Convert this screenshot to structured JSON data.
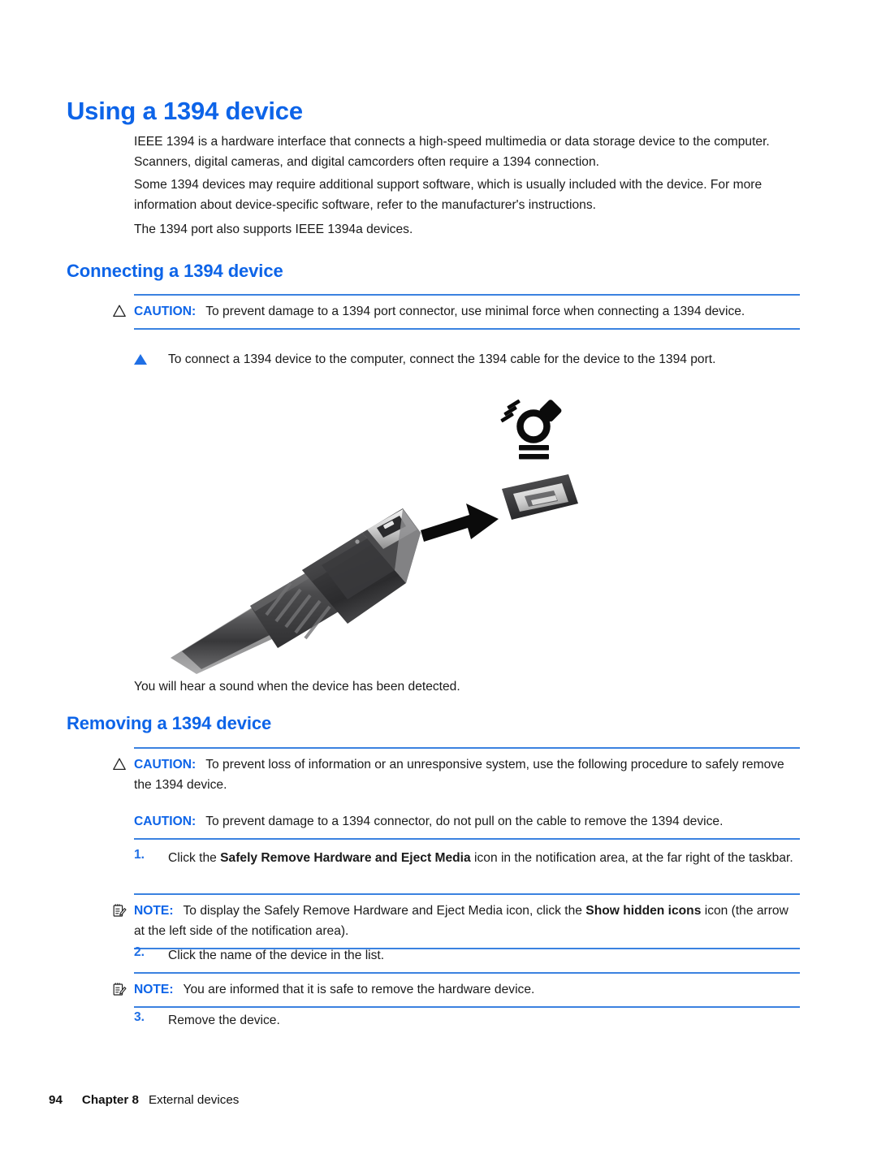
{
  "document": {
    "title": "Using a 1394 device",
    "intro_paragraphs": [
      "IEEE 1394 is a hardware interface that connects a high-speed multimedia or data storage device to the computer. Scanners, digital cameras, and digital camcorders often require a 1394 connection.",
      "Some 1394 devices may require additional support software, which is usually included with the device. For more information about device-specific software, refer to the manufacturer's instructions.",
      "The 1394 port also supports IEEE 1394a devices."
    ]
  },
  "connecting": {
    "heading": "Connecting a 1394 device",
    "caution_label": "CAUTION:",
    "caution_text": "To prevent damage to a 1394 port connector, use minimal force when connecting a 1394 device.",
    "bullet_text": "To connect a 1394 device to the computer, connect the 1394 cable for the device to the 1394 port.",
    "after_figure_text": "You will hear a sound when the device has been detected."
  },
  "figure": {
    "alt": "1394 cable connector being inserted into a 1394 port on the computer",
    "port_symbol_name": "firewire-1394-symbol",
    "arrow_name": "insertion-arrow"
  },
  "removing": {
    "heading": "Removing a 1394 device",
    "caution1_label": "CAUTION:",
    "caution1_text": "To prevent loss of information or an unresponsive system, use the following procedure to safely remove the 1394 device.",
    "caution2_label": "CAUTION:",
    "caution2_text": "To prevent damage to a 1394 connector, do not pull on the cable to remove the 1394 device.",
    "steps": [
      {
        "number": "1.",
        "text_before": "Click the ",
        "text_bold": "Safely Remove Hardware and Eject Media",
        "text_after": " icon in the notification area, at the far right of the taskbar."
      },
      {
        "number": "2.",
        "text_before": "Click the name of the device in the list.",
        "text_bold": "",
        "text_after": ""
      },
      {
        "number": "3.",
        "text_before": "Remove the device.",
        "text_bold": "",
        "text_after": ""
      }
    ],
    "note1_label": "NOTE:",
    "note1_before": "To display the Safely Remove Hardware and Eject Media icon, click the ",
    "note1_bold": "Show hidden icons",
    "note1_after": " icon (the arrow at the left side of the notification area).",
    "note2_label": "NOTE:",
    "note2_text": "You are informed that it is safe to remove the hardware device."
  },
  "footer": {
    "page_number": "94",
    "chapter": "Chapter 8",
    "chapter_title": "External devices"
  },
  "colors": {
    "heading_blue": "#0D64E8",
    "rule_blue": "#3B82E0",
    "marker_blue": "#1F6FE5",
    "body_black": "#1a1a1a"
  }
}
